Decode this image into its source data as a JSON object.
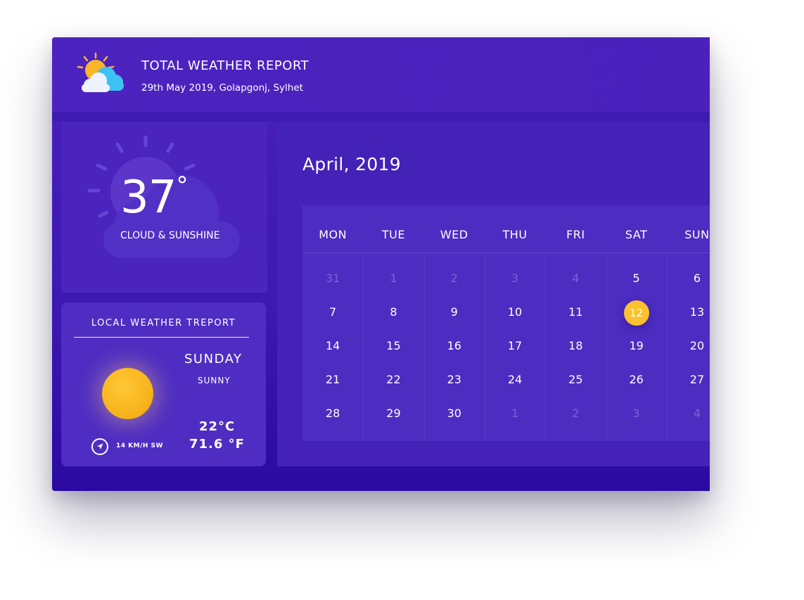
{
  "header": {
    "title": "TOTAL WEATHER REPORT",
    "subtitle": "29th May 2019, Golapgonj, Sylhet",
    "icon": "partly-cloudy-icon"
  },
  "current": {
    "temperature": "37",
    "unit": "°",
    "condition": "CLOUD & SUNSHINE"
  },
  "local": {
    "title": "LOCAL WEATHER TREPORT",
    "day": "SUNDAY",
    "condition": "SUNNY",
    "temp_c": "22°C",
    "temp_f": "71.6 °F",
    "wind": "14  KM/H SW",
    "wind_icon": "compass-icon"
  },
  "calendar": {
    "month": "April, 2019",
    "weekdays": [
      "MON",
      "TUE",
      "WED",
      "THU",
      "FRI",
      "SAT",
      "SUN"
    ],
    "selected_day": "12",
    "accent_color": "#f9c12e",
    "weeks": [
      [
        {
          "d": "31",
          "m": true
        },
        {
          "d": "1",
          "m": true
        },
        {
          "d": "2",
          "m": true
        },
        {
          "d": "3",
          "m": true
        },
        {
          "d": "4",
          "m": true
        },
        {
          "d": "5",
          "m": false
        },
        {
          "d": "6",
          "m": false
        }
      ],
      [
        {
          "d": "7",
          "m": false
        },
        {
          "d": "8",
          "m": false
        },
        {
          "d": "9",
          "m": false
        },
        {
          "d": "10",
          "m": false
        },
        {
          "d": "11",
          "m": false
        },
        {
          "d": "12",
          "m": false
        },
        {
          "d": "13",
          "m": false
        }
      ],
      [
        {
          "d": "14",
          "m": false
        },
        {
          "d": "15",
          "m": false
        },
        {
          "d": "16",
          "m": false
        },
        {
          "d": "17",
          "m": false
        },
        {
          "d": "18",
          "m": false
        },
        {
          "d": "19",
          "m": false
        },
        {
          "d": "20",
          "m": false
        }
      ],
      [
        {
          "d": "21",
          "m": false
        },
        {
          "d": "22",
          "m": false
        },
        {
          "d": "23",
          "m": false
        },
        {
          "d": "24",
          "m": false
        },
        {
          "d": "25",
          "m": false
        },
        {
          "d": "26",
          "m": false
        },
        {
          "d": "27",
          "m": false
        }
      ],
      [
        {
          "d": "28",
          "m": false
        },
        {
          "d": "29",
          "m": false
        },
        {
          "d": "30",
          "m": false
        },
        {
          "d": "1",
          "m": true
        },
        {
          "d": "2",
          "m": true
        },
        {
          "d": "3",
          "m": true
        },
        {
          "d": "4",
          "m": true
        }
      ]
    ]
  }
}
